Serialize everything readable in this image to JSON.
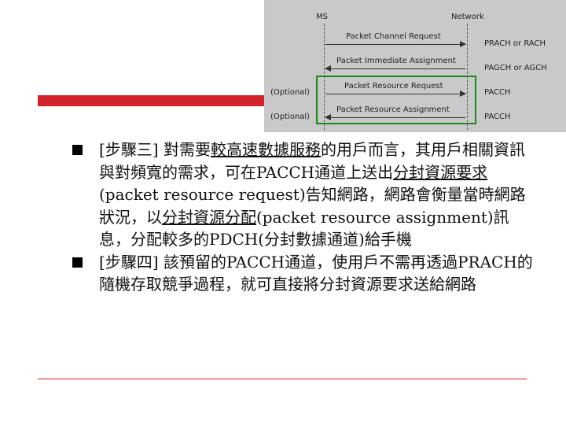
{
  "diagram": {
    "ms_label": "MS",
    "network_label": "Network",
    "messages": [
      {
        "text": "Packet Channel Request",
        "right": "PRACH or RACH",
        "left": ""
      },
      {
        "text": "Packet Immediate Assignment",
        "right": "PAGCH or AGCH",
        "left": ""
      },
      {
        "text": "Packet Resource Request",
        "right": "PACCH",
        "left": "(Optional)"
      },
      {
        "text": "Packet Resource Assignment",
        "right": "PACCH",
        "left": "(Optional)"
      }
    ]
  },
  "content": {
    "b1_a": "[步驟三] 對需要",
    "b1_u1": "較高速數據服務",
    "b1_b": "的用戶而言，其用戶相關資訊與對頻寬的需求，可在PACCH通道上送出",
    "b1_u2": "分封資源要求",
    "b1_c": "(packet resource request)告知網路，網路會衡量當時網路狀況，以",
    "b1_u3": "分封資源分配",
    "b1_d": "(packet resource assignment)訊息，分配較多的PDCH(分封數據通道)給手機",
    "b2": "[步驟四] 該預留的PACCH通道，使用戶不需再透過PRACH的隨機存取競爭過程，就可直接將分封資源要求送給網路"
  }
}
